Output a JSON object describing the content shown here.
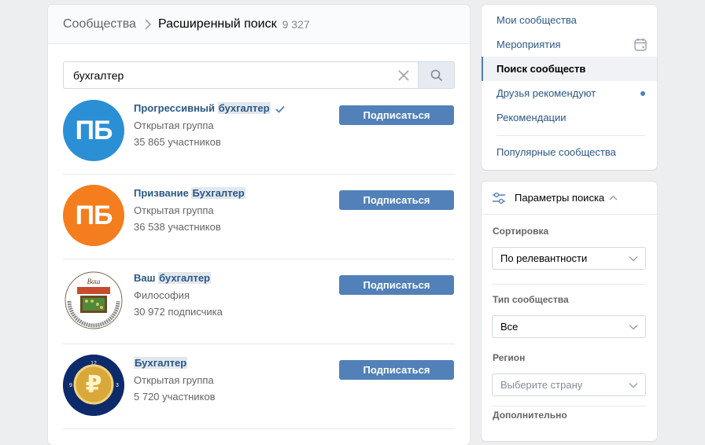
{
  "header": {
    "breadcrumb_parent": "Сообщества",
    "title": "Расширенный поиск",
    "count": "9 327"
  },
  "search": {
    "value": "бухгалтер"
  },
  "results": [
    {
      "name_pre": "Прогрессивный ",
      "name_hl": "бухгалтер",
      "name_post": "",
      "type": "Открытая группа",
      "members": "35 865 участников",
      "button": "Подписаться",
      "avatar_text": "ПБ",
      "avatar_color": "#2b8fd6",
      "verified": true
    },
    {
      "name_pre": "Призвание ",
      "name_hl": "Бухгалтер",
      "name_post": "",
      "type": "Открытая группа",
      "members": "36 538 участников",
      "button": "Подписаться",
      "avatar_text": "ПБ",
      "avatar_color": "#f47d1e",
      "verified": false
    },
    {
      "name_pre": "Ваш ",
      "name_hl": "бухгалтер",
      "name_post": "",
      "type": "Философия",
      "members": "30 972 подписчика",
      "button": "Подписаться",
      "avatar_text": "Ваш бухгалтер",
      "avatar_color": "#ffffff",
      "verified": false
    },
    {
      "name_pre": "",
      "name_hl": "Бухгалтер",
      "name_post": "",
      "type": "Открытая группа",
      "members": "5 720 участников",
      "button": "Подписаться",
      "avatar_text": "БУХГАЛТЕР",
      "avatar_color": "#0d2a6b",
      "verified": false
    }
  ],
  "nav": {
    "items": [
      {
        "label": "Мои сообщества"
      },
      {
        "label": "Мероприятия"
      },
      {
        "label": "Поиск сообществ"
      },
      {
        "label": "Друзья рекомендуют"
      },
      {
        "label": "Рекомендации"
      },
      {
        "label": "Популярные сообщества"
      }
    ]
  },
  "params": {
    "title": "Параметры поиска",
    "sort_label": "Сортировка",
    "sort_value": "По релевантности",
    "type_label": "Тип сообщества",
    "type_value": "Все",
    "region_label": "Регион",
    "region_placeholder": "Выберите страну",
    "extra_label": "Дополнительно"
  },
  "colors": {
    "accent": "#5181b8",
    "link": "#2a5885",
    "background": "#edeef0"
  }
}
